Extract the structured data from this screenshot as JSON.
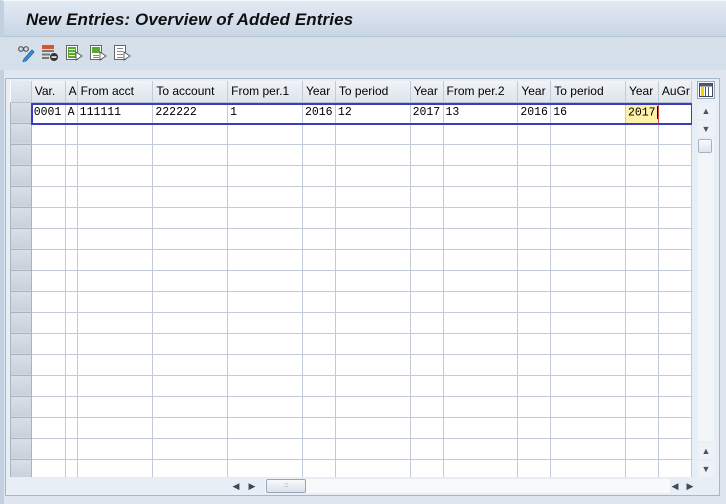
{
  "window": {
    "title": "New Entries: Overview of Added Entries"
  },
  "toolbar": {
    "buttons": [
      {
        "name": "display-change-icon",
        "tooltip": "Display/Change"
      },
      {
        "name": "delete-row-icon",
        "tooltip": "Delete"
      },
      {
        "name": "select-all-icon",
        "tooltip": "Select All"
      },
      {
        "name": "select-block-icon",
        "tooltip": "Select Block"
      },
      {
        "name": "deselect-all-icon",
        "tooltip": "Deselect All"
      }
    ]
  },
  "grid": {
    "columns": [
      {
        "key": "var",
        "label": "Var."
      },
      {
        "key": "a",
        "label": "A"
      },
      {
        "key": "from_acct",
        "label": "From acct"
      },
      {
        "key": "to_account",
        "label": "To account"
      },
      {
        "key": "from_per1",
        "label": "From per.1"
      },
      {
        "key": "year1",
        "label": "Year"
      },
      {
        "key": "to_period1",
        "label": "To period"
      },
      {
        "key": "year2",
        "label": "Year"
      },
      {
        "key": "from_per2",
        "label": "From per.2"
      },
      {
        "key": "year3",
        "label": "Year"
      },
      {
        "key": "to_period2",
        "label": "To period"
      },
      {
        "key": "year4",
        "label": "Year"
      },
      {
        "key": "augr",
        "label": "AuGr"
      }
    ],
    "rows": [
      {
        "var": "0001",
        "a": "A",
        "from_acct": "111111",
        "to_account": "222222",
        "from_per1": "1",
        "year1": "2016",
        "to_period1": "12",
        "year2": "2017",
        "from_per2": "13",
        "year3": "2016",
        "to_period2": "16",
        "year4": "2017",
        "augr": ""
      }
    ],
    "empty_row_count": 17,
    "active_cell": {
      "row": 0,
      "column": "year4"
    },
    "icons": {
      "column_config": "column-settings-icon",
      "scroll_up": "▲",
      "scroll_down": "▼",
      "scroll_left": "◀",
      "scroll_right": "▶",
      "thumb_grip": ":::"
    }
  }
}
